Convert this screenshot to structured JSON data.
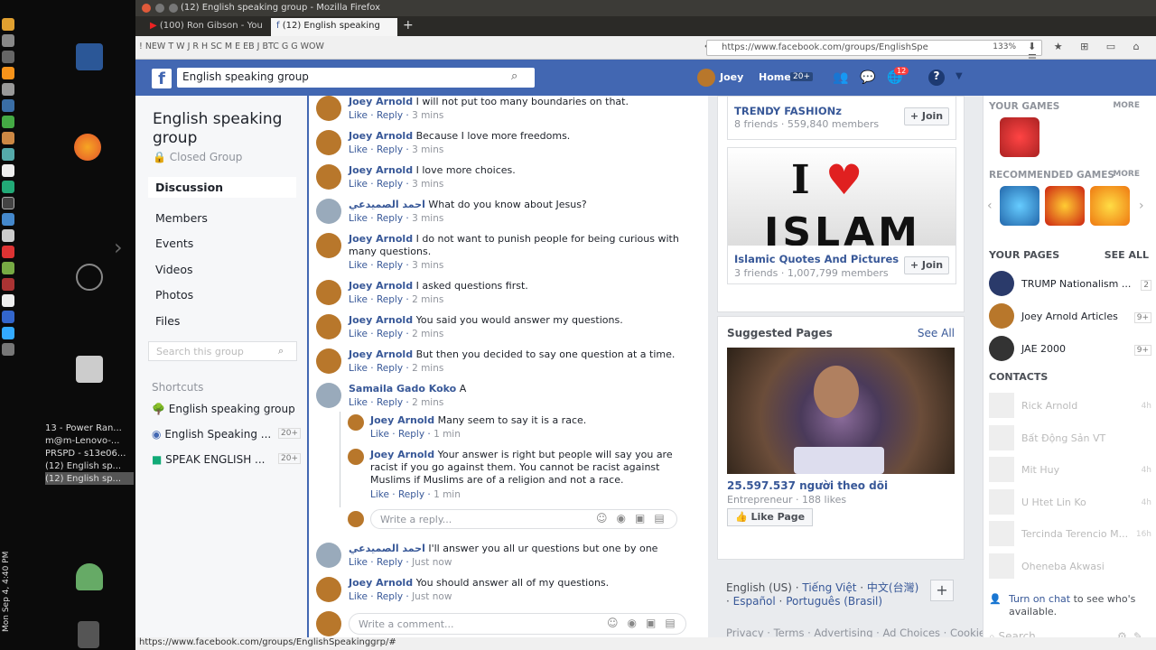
{
  "window": {
    "title": "(12) English speaking group - Mozilla Firefox",
    "statusurl": "https://www.facebook.com/groups/EnglishSpeakinggrp/#"
  },
  "tabs": [
    {
      "label": "(100) Ron Gibson - You"
    },
    {
      "label": "(12) English speaking"
    }
  ],
  "bookmarks": "! NEW T W J R H SC M E EB J BTC G G WOW",
  "url": {
    "value": "https://www.facebook.com/groups/EnglishSpe",
    "zoom": "133%"
  },
  "fbbar": {
    "search": "English speaking group",
    "user": "Joey",
    "home": "Home",
    "home_badge": "20+",
    "notif_badge": "12"
  },
  "group": {
    "title": "English speaking group",
    "privacy": "Closed Group",
    "search_placeholder": "Search this group",
    "shortcuts_label": "Shortcuts",
    "nav": [
      "Discussion",
      "Members",
      "Events",
      "Videos",
      "Photos",
      "Files"
    ],
    "shortcuts": [
      {
        "label": "English speaking group",
        "badge": ""
      },
      {
        "label": "English Speaking ...",
        "badge": "20+"
      },
      {
        "label": "SPEAK ENGLISH ...",
        "badge": "20+"
      }
    ]
  },
  "comments": [
    {
      "name": "Joey Arnold",
      "text": "I will not put too many boundaries on that.",
      "time": "3 mins"
    },
    {
      "name": "Joey Arnold",
      "text": "Because I love more freedoms.",
      "time": "3 mins"
    },
    {
      "name": "Joey Arnold",
      "text": "I love more choices.",
      "time": "3 mins"
    },
    {
      "name": "احمد الصميدعي",
      "text": "What do you know about Jesus?",
      "time": "3 mins"
    },
    {
      "name": "Joey Arnold",
      "text": "I do not want to punish people for being curious with many questions.",
      "time": "3 mins"
    },
    {
      "name": "Joey Arnold",
      "text": "I asked questions first.",
      "time": "2 mins"
    },
    {
      "name": "Joey Arnold",
      "text": "You said you would answer my questions.",
      "time": "2 mins"
    },
    {
      "name": "Joey Arnold",
      "text": "But then you decided to say one question at a time.",
      "time": "2 mins"
    },
    {
      "name": "Samaila Gado Koko",
      "text": "A",
      "time": "2 mins"
    }
  ],
  "replies": [
    {
      "name": "Joey Arnold",
      "text": "Many seem to say it is a race.",
      "time": "1 min"
    },
    {
      "name": "Joey Arnold",
      "text": "Your answer is right but people will say you are racist if you go against them. You cannot be racist against Muslims if Muslims are of a religion and not a race.",
      "time": "1 min"
    }
  ],
  "reply_placeholder": "Write a reply...",
  "comments2": [
    {
      "name": "احمد الصميدعي",
      "text": "I'll answer you all ur questions but one by one",
      "time": "Just now"
    },
    {
      "name": "Joey Arnold",
      "text": "You should answer all of my questions.",
      "time": "Just now"
    }
  ],
  "comment_placeholder": "Write a comment...",
  "actions": {
    "like": "Like",
    "reply": "Reply"
  },
  "groups_suggest": [
    {
      "name": "TRENDY FASHIONz",
      "meta": "8 friends · 559,840 members",
      "join": "Join"
    },
    {
      "name": "Islamic Quotes And Pictures",
      "meta": "3 friends · 1,007,799 members",
      "join": "Join"
    }
  ],
  "suggested_pages": {
    "title": "Suggested Pages",
    "see_all": "See All",
    "page_name": "25.597.537 người theo dõi",
    "page_meta": "Entrepreneur · 188 likes",
    "like_btn": "Like Page"
  },
  "languages": {
    "list": [
      "English (US)",
      "Tiếng Việt",
      "中文(台灣)",
      "Español",
      "Português (Brasil)"
    ]
  },
  "footer": "Privacy · Terms · Advertising · Ad Choices · Cookies · More",
  "sidebar": {
    "games": "YOUR GAMES",
    "more": "MORE",
    "rec": "RECOMMENDED GAMES",
    "pages": "YOUR PAGES",
    "see_all": "SEE ALL",
    "contacts": "CONTACTS",
    "pages_list": [
      {
        "name": "TRUMP Nationalism ...",
        "badge": "2"
      },
      {
        "name": "Joey Arnold Articles",
        "badge": "9+"
      },
      {
        "name": "JAE 2000",
        "badge": "9+"
      }
    ],
    "contacts_list": [
      {
        "name": "Rick Arnold",
        "time": "4h"
      },
      {
        "name": "Bất Động Sản VT",
        "time": ""
      },
      {
        "name": "Mit Huy",
        "time": "4h"
      },
      {
        "name": "U Htet Lin Ko",
        "time": "4h"
      },
      {
        "name": "Tercinda Terencio M...",
        "time": "16h"
      },
      {
        "name": "Oheneba Akwasi",
        "time": ""
      }
    ],
    "chat_link": "Turn on chat",
    "chat_text": " to see who's available.",
    "search": "Search"
  },
  "os": {
    "clock": "Mon Sep 4, 4:40 PM",
    "windows": [
      "13 - Power Ran...",
      "m@m-Lenovo-...",
      "PRSPD - s13e06...",
      "(12) English sp...",
      "(12) English sp..."
    ]
  }
}
